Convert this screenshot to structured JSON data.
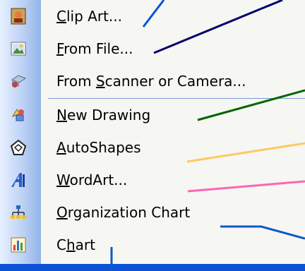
{
  "menu": {
    "items": [
      {
        "pre": "",
        "key": "C",
        "post": "lip Art...",
        "icon": "clip-art-icon"
      },
      {
        "pre": "",
        "key": "F",
        "post": "rom File...",
        "icon": "picture-from-file-icon"
      },
      {
        "pre": "From ",
        "key": "S",
        "post": "canner or Camera...",
        "icon": "scanner-camera-icon"
      },
      {
        "pre": "",
        "key": "N",
        "post": "ew Drawing",
        "icon": "new-drawing-icon"
      },
      {
        "pre": "",
        "key": "A",
        "post": "utoShapes",
        "icon": "autoshapes-icon"
      },
      {
        "pre": "",
        "key": "W",
        "post": "ordArt...",
        "icon": "wordart-icon"
      },
      {
        "pre": "",
        "key": "O",
        "post": "rganization Chart",
        "icon": "organization-chart-icon"
      },
      {
        "pre": "C",
        "key": "h",
        "post": "art",
        "icon": "chart-icon"
      }
    ]
  },
  "colors": {
    "background": "#0b52d6",
    "menu_bg": "#f6f6f2",
    "callout_navy": "#00006e",
    "callout_green": "#006400",
    "callout_gold": "#ffc864",
    "callout_pink": "#ff64b4",
    "callout_blue": "#0a5ac8"
  }
}
